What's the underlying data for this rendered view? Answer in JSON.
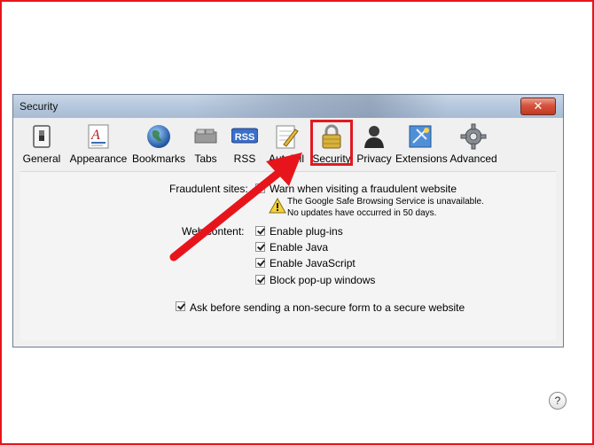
{
  "window": {
    "title": "Security",
    "close_label": "✕"
  },
  "toolbar": {
    "items": [
      {
        "label": "General",
        "icon": "switch-icon"
      },
      {
        "label": "Appearance",
        "icon": "font-icon"
      },
      {
        "label": "Bookmarks",
        "icon": "globe-icon"
      },
      {
        "label": "Tabs",
        "icon": "tabs-icon"
      },
      {
        "label": "RSS",
        "icon": "rss-icon"
      },
      {
        "label": "AutoFill",
        "icon": "pencil-icon"
      },
      {
        "label": "Security",
        "icon": "lock-icon"
      },
      {
        "label": "Privacy",
        "icon": "person-icon"
      },
      {
        "label": "Extensions",
        "icon": "puzzle-icon"
      },
      {
        "label": "Advanced",
        "icon": "gear-icon"
      }
    ],
    "rss_badge": "RSS"
  },
  "fraud": {
    "label": "Fraudulent sites:",
    "checkbox": "Warn when visiting a fraudulent website",
    "note1": "The Google Safe Browsing Service is unavailable.",
    "note2": "No updates have occurred in 50 days."
  },
  "web": {
    "label": "Web content:",
    "options": [
      "Enable plug-ins",
      "Enable Java",
      "Enable JavaScript",
      "Block pop-up windows"
    ]
  },
  "ask": "Ask before sending a non-secure form to a secure website",
  "help": "?",
  "colors": {
    "highlight": "#e21921",
    "arrow": "#e8141c"
  }
}
